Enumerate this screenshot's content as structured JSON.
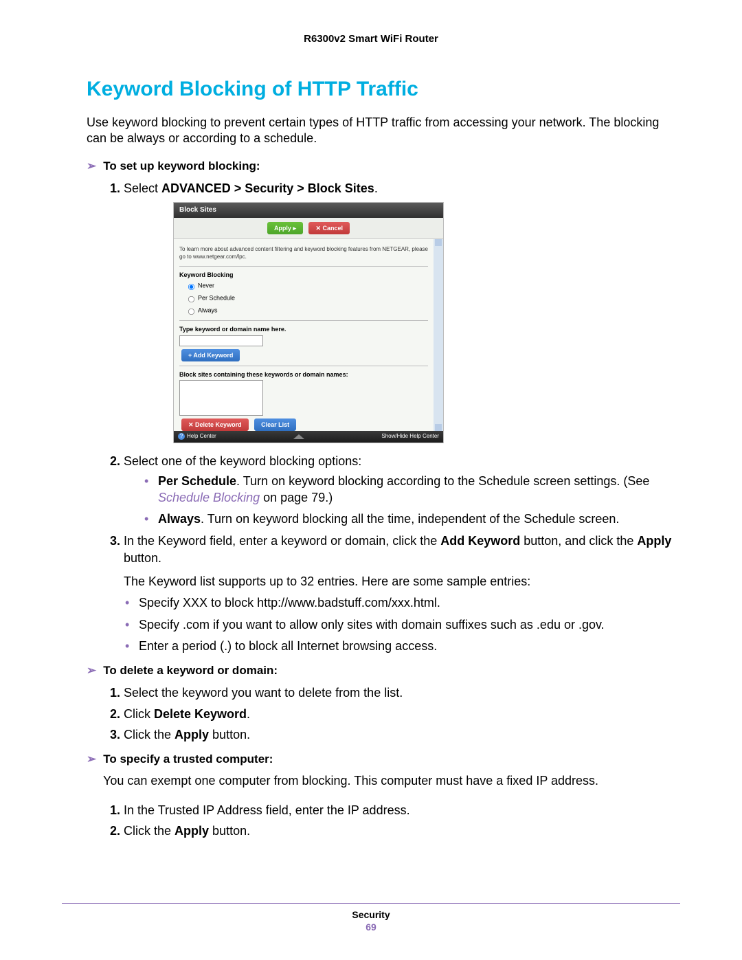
{
  "header": {
    "product": "R6300v2 Smart WiFi Router"
  },
  "heading": "Keyword Blocking of HTTP Traffic",
  "intro": "Use keyword blocking to prevent certain types of HTTP traffic from accessing your network. The blocking can be always or according to a schedule.",
  "proc1": {
    "title": "To set up keyword blocking:",
    "step1_prefix": "Select ",
    "step1_path": "ADVANCED > Security > Block Sites",
    "step1_suffix": ".",
    "step2": "Select one of the keyword blocking options:",
    "opt_per_schedule_label": "Per Schedule",
    "opt_per_schedule_text": ". Turn on keyword blocking according to the Schedule screen settings. (See ",
    "opt_per_schedule_ref": "Schedule Blocking",
    "opt_per_schedule_tail": " on page 79.)",
    "opt_always_label": "Always",
    "opt_always_text": ". Turn on keyword blocking all the time, independent of the Schedule screen.",
    "step3_a": "In the Keyword field, enter a keyword or domain, click the ",
    "step3_b": "Add Keyword",
    "step3_c": " button, and click the ",
    "step3_d": "Apply",
    "step3_e": " button.",
    "note": "The Keyword list supports up to 32 entries. Here are some sample entries:",
    "samples": [
      "Specify XXX to block http://www.badstuff.com/xxx.html.",
      "Specify .com if you want to allow only sites with domain suffixes such as .edu or .gov.",
      "Enter a period (.) to block all Internet browsing access."
    ]
  },
  "proc2": {
    "title": "To delete a keyword or domain:",
    "step1": "Select the keyword you want to delete from the list.",
    "step2_a": "Click ",
    "step2_b": "Delete Keyword",
    "step2_c": ".",
    "step3_a": "Click the ",
    "step3_b": "Apply",
    "step3_c": " button."
  },
  "proc3": {
    "title": "To specify a trusted computer:",
    "intro": "You can exempt one computer from blocking. This computer must have a fixed IP address.",
    "step1": "In the Trusted IP Address field, enter the IP address.",
    "step2_a": "Click the ",
    "step2_b": "Apply",
    "step2_c": " button."
  },
  "ui": {
    "title": "Block Sites",
    "apply": "Apply ▸",
    "cancel": "✕ Cancel",
    "note": "To learn more about advanced content filtering and keyword blocking features from NETGEAR, please go to www.netgear.com/lpc.",
    "section_kb": "Keyword Blocking",
    "radio_never": "Never",
    "radio_sched": "Per Schedule",
    "radio_always": "Always",
    "type_label": "Type keyword or domain name here.",
    "add_keyword": "+ Add Keyword",
    "list_label": "Block sites containing these keywords or domain names:",
    "delete_keyword": "✕ Delete Keyword",
    "clear_list": "Clear List",
    "help_center": "Help Center",
    "show_hide": "Show/Hide Help Center"
  },
  "footer": {
    "section": "Security",
    "page": "69"
  }
}
